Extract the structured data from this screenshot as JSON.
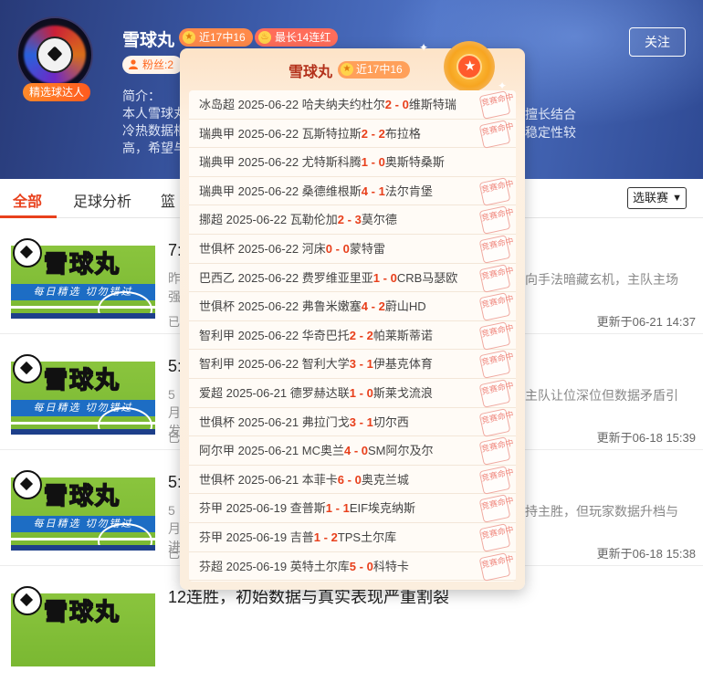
{
  "profile": {
    "name": "雪球丸",
    "badge": "精选球达人",
    "tag_recent": "近17中16",
    "tag_streak": "最长14连红",
    "fans_label": "粉丝:2",
    "intro_label": "简介：",
    "intro_lines": [
      "本人雪球丸",
      "冷热数据相",
      "高，希望与"
    ],
    "intro_right_lines": [
      "擅长结合",
      "稳定性较"
    ],
    "follow_label": "关注"
  },
  "tabs": {
    "items": [
      "全部",
      "足球分析",
      "篮"
    ],
    "active_index": 0,
    "league_select": "选联赛"
  },
  "articles": [
    {
      "title": "7:",
      "snippet_left": "昨强",
      "snippet_right": "向手法暗藏玄机，主队主场",
      "meta": "已",
      "date": "更新于06-21 14:37",
      "thumb_title": "雪球丸",
      "thumb_sub": "每日精选 切勿错过"
    },
    {
      "title": "5:",
      "snippet_left": "5月发",
      "snippet_right": "主队让位深位但数据矛盾引",
      "meta": "已",
      "date": "更新于06-18 15:39",
      "thumb_title": "雪球丸",
      "thumb_sub": "每日精选 切勿错过"
    },
    {
      "title": "5:",
      "snippet_left": "5月进",
      "snippet_right": "持主胜，但玩家数据升档与",
      "meta": "已",
      "date": "更新于06-18 15:38",
      "thumb_title": "雪球丸",
      "thumb_sub": "每日精选 切勿错过"
    },
    {
      "title": "12连胜，初始数据与真实表现严重割裂",
      "snippet_left": "",
      "snippet_right": "",
      "meta": "",
      "date": "",
      "thumb_title": "雪球丸",
      "thumb_sub": ""
    }
  ],
  "popup": {
    "name": "雪球丸",
    "tag": "近17中16",
    "stamp_text": "竞赛命中",
    "records": [
      {
        "league": "冰岛超",
        "date": "2025-06-22",
        "home": "哈夫纳夫约杜尔",
        "hs": "2",
        "sep": " - ",
        "as": "0",
        "away": "维斯特瑞",
        "hit": true
      },
      {
        "league": "瑞典甲",
        "date": "2025-06-22",
        "home": "瓦斯特拉斯",
        "hs": "2",
        "sep": " - ",
        "as": "2",
        "away": "布拉格",
        "hit": true
      },
      {
        "league": "瑞典甲",
        "date": "2025-06-22",
        "home": "尤特斯科腾",
        "hs": "1",
        "sep": " - ",
        "as": "0",
        "away": "奥斯特桑斯",
        "hit": false
      },
      {
        "league": "瑞典甲",
        "date": "2025-06-22",
        "home": "桑德维根斯",
        "hs": "4",
        "sep": " - ",
        "as": "1",
        "away": "法尔肯堡",
        "hit": true
      },
      {
        "league": "挪超",
        "date": "2025-06-22",
        "home": "瓦勒伦加",
        "hs": "2",
        "sep": " - ",
        "as": "3",
        "away": "莫尔德",
        "hit": true
      },
      {
        "league": "世俱杯",
        "date": "2025-06-22",
        "home": "河床",
        "hs": "0",
        "sep": " - ",
        "as": "0",
        "away": "蒙特雷",
        "hit": true
      },
      {
        "league": "巴西乙",
        "date": "2025-06-22",
        "home": "费罗维亚里亚",
        "hs": "1",
        "sep": " - ",
        "as": "0",
        "away": "CRB马瑟欧",
        "hit": true
      },
      {
        "league": "世俱杯",
        "date": "2025-06-22",
        "home": "弗鲁米嫩塞",
        "hs": "4",
        "sep": " - ",
        "as": "2",
        "away": "蔚山HD",
        "hit": true
      },
      {
        "league": "智利甲",
        "date": "2025-06-22",
        "home": "华奇巴托",
        "hs": "2",
        "sep": " - ",
        "as": "2",
        "away": "帕莱斯蒂诺",
        "hit": true
      },
      {
        "league": "智利甲",
        "date": "2025-06-22",
        "home": "智利大学",
        "hs": "3",
        "sep": " - ",
        "as": "1",
        "away": "伊基克体育",
        "hit": true
      },
      {
        "league": "爱超",
        "date": "2025-06-21",
        "home": "德罗赫达联",
        "hs": "1",
        "sep": " - ",
        "as": "0",
        "away": "斯莱戈流浪",
        "hit": true
      },
      {
        "league": "世俱杯",
        "date": "2025-06-21",
        "home": "弗拉门戈",
        "hs": "3",
        "sep": " - ",
        "as": "1",
        "away": "切尔西",
        "hit": true
      },
      {
        "league": "阿尔甲",
        "date": "2025-06-21",
        "home": "MC奥兰",
        "hs": "4",
        "sep": " - ",
        "as": "0",
        "away": "SM阿尔及尔",
        "hit": true
      },
      {
        "league": "世俱杯",
        "date": "2025-06-21",
        "home": "本菲卡",
        "hs": "6",
        "sep": " - ",
        "as": "0",
        "away": "奥克兰城",
        "hit": true
      },
      {
        "league": "芬甲",
        "date": "2025-06-19",
        "home": "查普斯",
        "hs": "1",
        "sep": " - ",
        "as": "1",
        "away": "EIF埃克纳斯",
        "hit": true
      },
      {
        "league": "芬甲",
        "date": "2025-06-19",
        "home": "吉普",
        "hs": "1",
        "sep": " - ",
        "as": "2",
        "away": "TPS土尔库",
        "hit": true
      },
      {
        "league": "芬超",
        "date": "2025-06-19",
        "home": "英特土尔库",
        "hs": "5",
        "sep": " - ",
        "as": "0",
        "away": "科特卡",
        "hit": true
      }
    ]
  }
}
